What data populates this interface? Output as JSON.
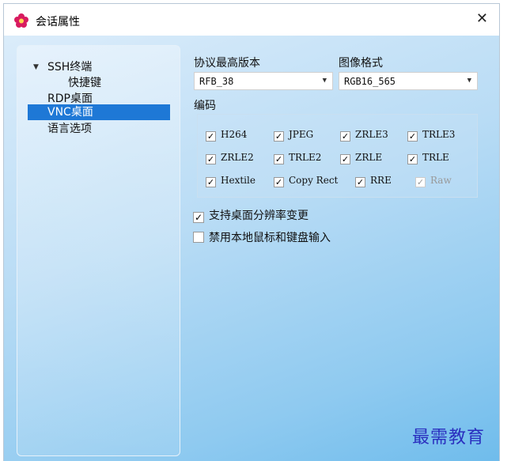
{
  "window": {
    "title": "会话属性",
    "close_glyph": "✕",
    "app_icon": "flower-logo-icon"
  },
  "tree": {
    "items": [
      {
        "label": "SSH终端",
        "expanded": true
      },
      {
        "label": "快捷键"
      },
      {
        "label": "RDP桌面"
      },
      {
        "label": "VNC桌面",
        "selected": true
      },
      {
        "label": "语言选项"
      }
    ]
  },
  "form": {
    "protocol_label": "协议最高版本",
    "protocol_value": "RFB_38",
    "format_label": "图像格式",
    "format_value": "RGB16_565",
    "encoding_label": "编码",
    "encodings": [
      {
        "label": "H264",
        "checked": true
      },
      {
        "label": "JPEG",
        "checked": true
      },
      {
        "label": "ZRLE3",
        "checked": true
      },
      {
        "label": "TRLE3",
        "checked": true
      },
      {
        "label": "ZRLE2",
        "checked": true
      },
      {
        "label": "TRLE2",
        "checked": true
      },
      {
        "label": "ZRLE",
        "checked": true
      },
      {
        "label": "TRLE",
        "checked": true
      },
      {
        "label": "Hextile",
        "checked": true
      },
      {
        "label": "Copy Rect",
        "checked": true
      },
      {
        "label": "RRE",
        "checked": true
      },
      {
        "label": "Raw",
        "checked": true,
        "disabled": true
      }
    ],
    "options": [
      {
        "label": "支持桌面分辨率变更",
        "checked": true
      },
      {
        "label": "禁用本地鼠标和键盘输入",
        "checked": false
      }
    ]
  },
  "watermark": "最需教育",
  "colors": {
    "selection": "#1e78d6",
    "watermark": "#2a2fbf",
    "accent_logo": "#d81b60"
  }
}
